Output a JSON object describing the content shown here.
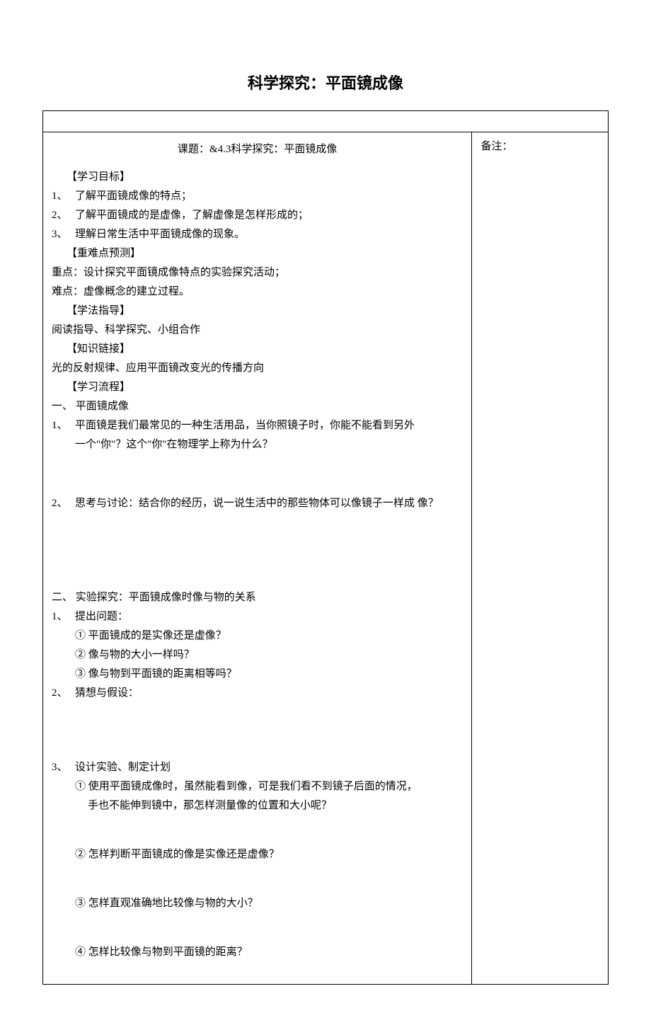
{
  "page_title": "科学探究：平面镜成像",
  "notes_label": "备注：",
  "lesson_header": "课题：&4.3科学探究：平面镜成像",
  "sections": {
    "goals": {
      "head": "【学习目标】",
      "items": [
        {
          "num": "1、",
          "text": "了解平面镜成像的特点；"
        },
        {
          "num": "2、",
          "text": "了解平面镜成的是虚像，了解虚像是怎样形成的；"
        },
        {
          "num": "3、",
          "text": "理解日常生活中平面镜成像的现象。"
        }
      ]
    },
    "keypoints": {
      "head": "【重难点预测】",
      "items": [
        "重点：设计探究平面镜成像特点的实验探究活动；",
        "难点：虚像概念的建立过程。"
      ]
    },
    "method": {
      "head": "【学法指导】",
      "text": "阅读指导、科学探究、小组合作"
    },
    "link": {
      "head": "【知识链接】",
      "text": "光的反射规律、应用平面镜改变光的传播方向"
    },
    "flow": {
      "head": "【学习流程】",
      "part1": {
        "title": "一、 平面镜成像",
        "q1": {
          "num": "1、",
          "line1": "平面镜是我们最常见的一种生活用品，当你照镜子时，你能不能看到另外",
          "line2": "一个\"你\"？这个\"你\"在物理学上称为什么？"
        },
        "q2": {
          "num": "2、",
          "text": "思考与讨论：结合你的经历，说一说生活中的那些物体可以像镜子一样成 像？"
        }
      },
      "part2": {
        "title": "二、 实验探究：平面镜成像时像与物的关系",
        "step1": {
          "num": "1、",
          "label": "提出问题：",
          "subs": [
            "① 平面镜成的是实像还是虚像？",
            "② 像与物的大小一样吗？",
            "③ 像与物到平面镜的距离相等吗？"
          ]
        },
        "step2": {
          "num": "2、",
          "label": "猜想与假设："
        },
        "step3": {
          "num": "3、",
          "label": "设计实验、制定计划",
          "sub1_line1": "① 使用平面镜成像时，虽然能看到像，可是我们看不到镜子后面的情况，",
          "sub1_line2": "手也不能伸到镜中，那怎样测量像的位置和大小呢？",
          "subs_rest": [
            "② 怎样判断平面镜成的像是实像还是虚像？",
            "③ 怎样直观准确地比较像与物的大小？",
            "④ 怎样比较像与物到平面镜的距离？"
          ]
        }
      }
    }
  }
}
